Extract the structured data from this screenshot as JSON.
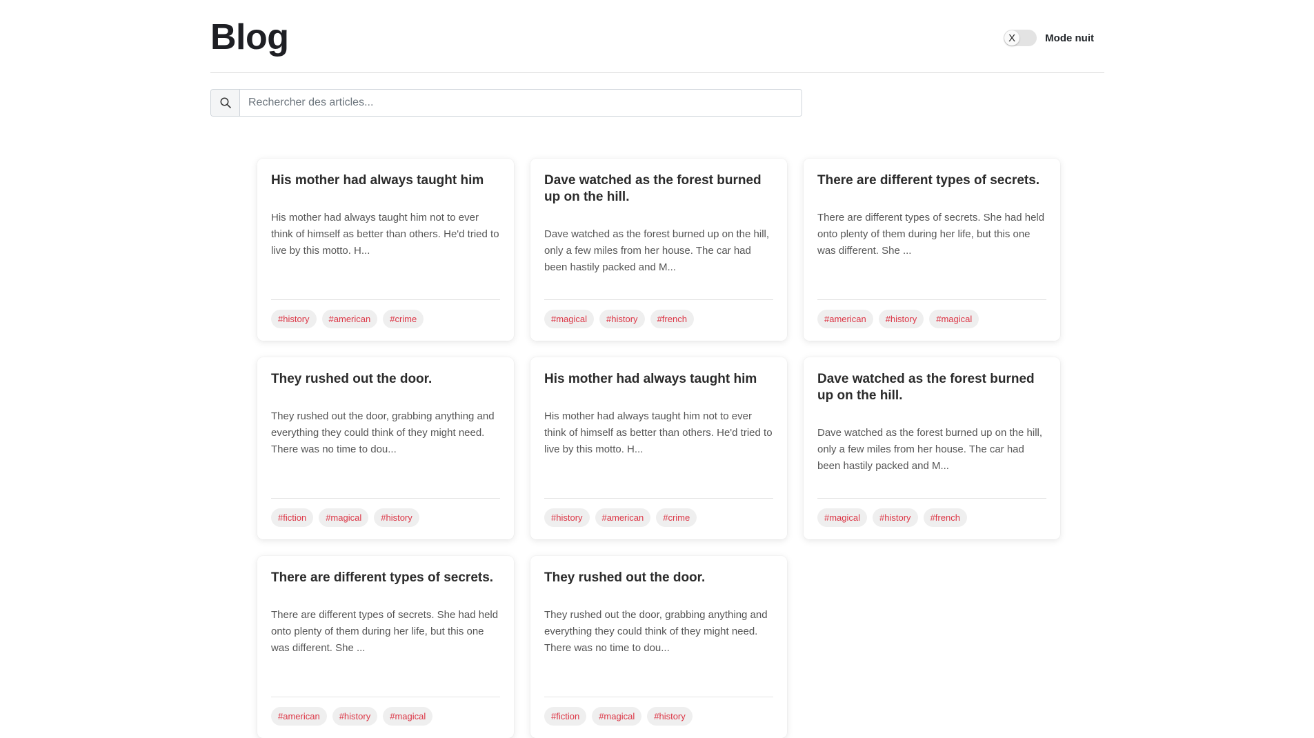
{
  "header": {
    "title": "Blog",
    "night_mode_label": "Mode nuit",
    "toggle_knob_text": "X"
  },
  "search": {
    "placeholder": "Rechercher des articles...",
    "icon": "search-icon"
  },
  "colors": {
    "tag_text": "#dc3545",
    "tag_bg": "#efefef"
  },
  "articles": [
    {
      "title": "His mother had always taught him",
      "excerpt": "His mother had always taught him not to ever think of himself as better than others. He'd tried to live by this motto. H...",
      "tags": [
        "#history",
        "#american",
        "#crime"
      ]
    },
    {
      "title": "Dave watched as the forest burned up on the hill.",
      "excerpt": "Dave watched as the forest burned up on the hill, only a few miles from her house. The car had been hastily packed and M...",
      "tags": [
        "#magical",
        "#history",
        "#french"
      ]
    },
    {
      "title": "There are different types of secrets.",
      "excerpt": "There are different types of secrets. She had held onto plenty of them during her life, but this one was different. She ...",
      "tags": [
        "#american",
        "#history",
        "#magical"
      ]
    },
    {
      "title": "They rushed out the door.",
      "excerpt": "They rushed out the door, grabbing anything and everything they could think of they might need. There was no time to dou...",
      "tags": [
        "#fiction",
        "#magical",
        "#history"
      ]
    },
    {
      "title": "His mother had always taught him",
      "excerpt": "His mother had always taught him not to ever think of himself as better than others. He'd tried to live by this motto. H...",
      "tags": [
        "#history",
        "#american",
        "#crime"
      ]
    },
    {
      "title": "Dave watched as the forest burned up on the hill.",
      "excerpt": "Dave watched as the forest burned up on the hill, only a few miles from her house. The car had been hastily packed and M...",
      "tags": [
        "#magical",
        "#history",
        "#french"
      ]
    },
    {
      "title": "There are different types of secrets.",
      "excerpt": "There are different types of secrets. She had held onto plenty of them during her life, but this one was different. She ...",
      "tags": [
        "#american",
        "#history",
        "#magical"
      ]
    },
    {
      "title": "They rushed out the door.",
      "excerpt": "They rushed out the door, grabbing anything and everything they could think of they might need. There was no time to dou...",
      "tags": [
        "#fiction",
        "#magical",
        "#history"
      ]
    }
  ]
}
